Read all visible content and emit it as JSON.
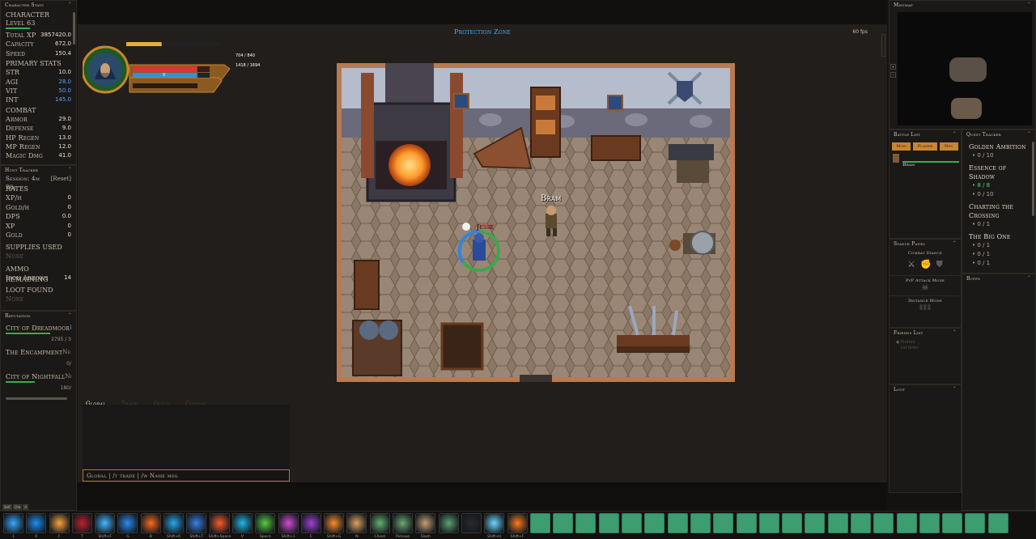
{
  "character": {
    "header": "Character Stats",
    "title": "CHARACTER",
    "level": "Level 63",
    "rows": [
      {
        "label": "Total XP",
        "value": "3857420.0"
      },
      {
        "label": "Capacity",
        "value": "672.0"
      },
      {
        "label": "Speed",
        "value": "150.4"
      }
    ],
    "primary_title": "PRIMARY STATS",
    "primary": [
      {
        "label": "STR",
        "value": "10.0",
        "color": "#e8e0d0"
      },
      {
        "label": "AGI",
        "value": "28.0",
        "color": "#5aa0ff"
      },
      {
        "label": "VIT",
        "value": "50.0",
        "color": "#5aa0ff"
      },
      {
        "label": "INT",
        "value": "145.0",
        "color": "#5aa0ff"
      }
    ],
    "combat_title": "COMBAT",
    "combat": [
      {
        "label": "Armor",
        "value": "29.0"
      },
      {
        "label": "Defense",
        "value": "9.0"
      },
      {
        "label": "HP Regen",
        "value": "13.0"
      },
      {
        "label": "MP Regen",
        "value": "12.0"
      },
      {
        "label": "Magic Dmg",
        "value": "41.0"
      }
    ]
  },
  "hunt": {
    "header": "Hunt Tracker",
    "session": "Session: 4m 78s",
    "reset": "[Reset]",
    "rates_title": "RATES",
    "rates": [
      {
        "label": "XP/h",
        "value": "0"
      },
      {
        "label": "Gold/h",
        "value": "0"
      },
      {
        "label": "DPS",
        "value": "0.0"
      },
      {
        "label": "XP",
        "value": "0"
      },
      {
        "label": "Gold",
        "value": "0"
      }
    ],
    "supplies_title": "SUPPLIES USED",
    "supplies": "None",
    "ammo_title": "AMMO REMAINING",
    "ammo_label": "Iron Arrows",
    "ammo_value": "14",
    "loot_title": "LOOT FOUND",
    "loot": "None"
  },
  "reputation": {
    "header": "Reputation",
    "factions": [
      {
        "name": "City of Dreadmoor",
        "status": "Hono",
        "value": "2795 / 3"
      },
      {
        "name": "The Encampment",
        "status": "Neut",
        "value": "0/"
      },
      {
        "name": "City of Nightfall",
        "status": "Neut",
        "value": "180/"
      }
    ]
  },
  "hud": {
    "zone": "Protection Zone",
    "fps": "60 fps",
    "hp": "704 / 840",
    "mp": "1418 / 1694",
    "xp": "0",
    "hp_frac": 0.84,
    "mp_frac": 0.84,
    "top_frac": 0.38
  },
  "scene": {
    "npc_name": "Bram",
    "player_name": "Jesse"
  },
  "chat": {
    "tabs": [
      "Global",
      "Trade",
      "Guild",
      "Combat"
    ],
    "placeholder": "Global | /t trade | /w Name msg"
  },
  "minimap": {
    "header": "Minimap"
  },
  "battle": {
    "header": "Battle List",
    "filters": [
      "Mon",
      "Player",
      "Npc"
    ],
    "entry": "Bram"
  },
  "quests": {
    "header": "Quest Tracker",
    "items": [
      {
        "title": "Golden Ambition",
        "subs": [
          {
            "text": "• 0 / 10",
            "done": false
          }
        ]
      },
      {
        "title": "Essence of Shadow",
        "subs": [
          {
            "text": "• 8 / 8",
            "done": true
          },
          {
            "text": "• 0 / 10",
            "done": false
          }
        ]
      },
      {
        "title": "Charting the Crossing",
        "subs": [
          {
            "text": "• 0 / 1",
            "done": false
          }
        ]
      },
      {
        "title": "The Big One",
        "subs": [
          {
            "text": "• 0 / 1",
            "done": false
          },
          {
            "text": "• 0 / 1",
            "done": false
          },
          {
            "text": "• 0 / 1",
            "done": false
          }
        ]
      }
    ]
  },
  "stance": {
    "header": "Stance Panel",
    "combat": "Combat Stance",
    "pvp": "PvP Attack Mode",
    "distance": "Distance Mode"
  },
  "friends": {
    "header": "Friends List",
    "entry1": "Endren",
    "entry2": "Lvl Unkn"
  },
  "buffs": {
    "header": "Buffs"
  },
  "loot": {
    "header": "Loot"
  },
  "bottom_tabs": [
    "Self",
    "Cha",
    "A"
  ],
  "hotbar": [
    {
      "key": "1",
      "color": "#3aa8ff"
    },
    {
      "key": "R",
      "color": "#1e8ff0"
    },
    {
      "key": "F",
      "color": "#ffa23a"
    },
    {
      "key": "T",
      "color": "#c0202a"
    },
    {
      "key": "Shift+F",
      "color": "#45b8ff"
    },
    {
      "key": "G",
      "color": "#2f8cf0"
    },
    {
      "key": "B",
      "color": "#ff6a1a"
    },
    {
      "key": "Shift+R",
      "color": "#2aa8e8"
    },
    {
      "key": "Shift+T",
      "color": "#3a80e0"
    },
    {
      "key": "Shift+Space",
      "color": "#ff5a2a"
    },
    {
      "key": "V",
      "color": "#22b8e0"
    },
    {
      "key": "Space",
      "color": "#5acd3a"
    },
    {
      "key": "Shift+1",
      "color": "#d84ad0"
    },
    {
      "key": "C",
      "color": "#a040d0"
    },
    {
      "key": "Shift+G",
      "color": "#ff8a2a"
    },
    {
      "key": "N",
      "color": "#e0a060"
    },
    {
      "key": "Chisel",
      "color": "#6ab06a"
    },
    {
      "key": "Pickaxe",
      "color": "#70a870"
    },
    {
      "key": "Slash",
      "color": "#c8a070"
    },
    {
      "key": "",
      "color": "#60a070"
    },
    {
      "key": "",
      "color": "#2a2a2a"
    },
    {
      "key": "Shift+H",
      "color": "#70d8ff"
    },
    {
      "key": "Shift+F",
      "color": "#ff7a1a"
    }
  ],
  "empty_slots": 21,
  "colors": {
    "hp": "#d8363a",
    "mp": "#3a8ed8",
    "gold": "#e8b030",
    "green": "#3bab4f"
  }
}
